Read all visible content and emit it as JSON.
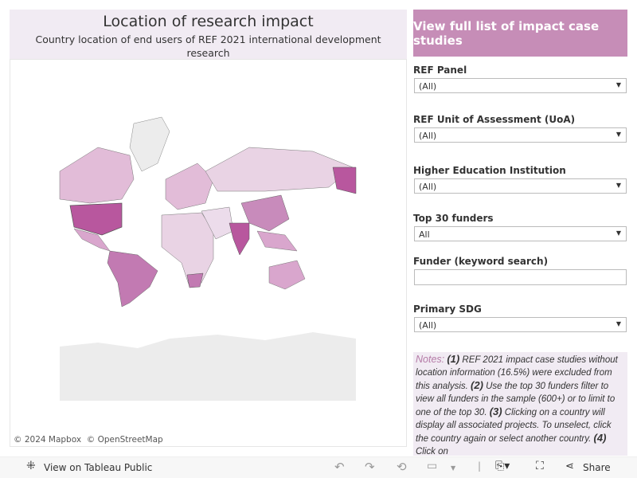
{
  "header": {
    "title": "Location of research impact",
    "subtitle": "Country location of end users of REF 2021 international development research"
  },
  "map": {
    "attribution_mapbox": "© 2024 Mapbox",
    "attribution_osm": "© OpenStreetMap",
    "colors": {
      "high": "#b8579e",
      "mid": "#d9a6cd",
      "low": "#e9d3e4",
      "none": "#ececec"
    }
  },
  "cta": {
    "label": "View full list of impact case studies",
    "color": "#c68db7"
  },
  "filters": [
    {
      "label": "REF Panel",
      "value": "(All)"
    },
    {
      "label": "REF Unit of Assessment (UoA)",
      "value": "(All)"
    },
    {
      "label": "Higher Education Institution",
      "value": "(All)"
    },
    {
      "label": "Top 30 funders",
      "value": "All"
    },
    {
      "label": "Funder (keyword search)",
      "value": ""
    },
    {
      "label": "Primary SDG",
      "value": "(All)"
    }
  ],
  "notes": {
    "heading": "Notes:",
    "p1n": "(1)",
    "p1": " REF 2021 impact case studies without location information (16.5%) were excluded from this analysis. ",
    "p2n": "(2)",
    "p2": " Use the top 30 funders filter to view all funders in the sample  (600+) or to limit to one of the top 30. ",
    "p3n": "(3)",
    "p3": " Clicking on a country will display all associated projects. To unselect, click the country again or select another country. ",
    "p4n": "(4)",
    "p4": " Click on"
  },
  "toolbar": {
    "view_label": "View on Tableau Public",
    "share_label": "Share"
  }
}
